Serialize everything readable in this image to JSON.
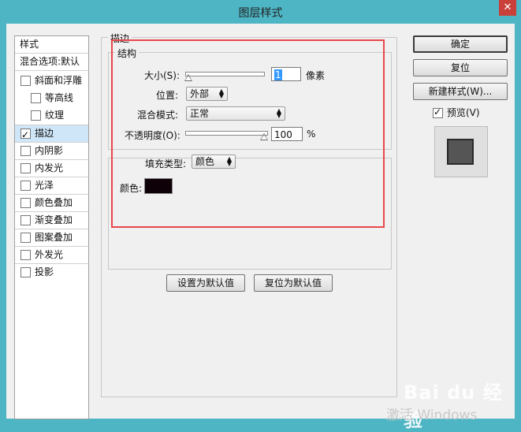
{
  "window": {
    "title": "图层样式",
    "close_glyph": "✕"
  },
  "style_list": {
    "header": "样式",
    "blend_options": "混合选项:默认",
    "items": [
      {
        "label": "斜面和浮雕",
        "checked": false
      },
      {
        "label": "等高线",
        "checked": false
      },
      {
        "label": "纹理",
        "checked": false
      },
      {
        "label": "描边",
        "checked": true,
        "selected": true
      },
      {
        "label": "内阴影",
        "checked": false
      },
      {
        "label": "内发光",
        "checked": false
      },
      {
        "label": "光泽",
        "checked": false
      },
      {
        "label": "颜色叠加",
        "checked": false
      },
      {
        "label": "渐变叠加",
        "checked": false
      },
      {
        "label": "图案叠加",
        "checked": false
      },
      {
        "label": "外发光",
        "checked": false
      },
      {
        "label": "投影",
        "checked": false
      }
    ]
  },
  "stroke_panel": {
    "title": "描边",
    "structure": {
      "title": "结构",
      "size_label": "大小(S):",
      "size_value": "1",
      "size_unit": "像素",
      "position_label": "位置:",
      "position_value": "外部",
      "blend_mode_label": "混合模式:",
      "blend_mode_value": "正常",
      "opacity_label": "不透明度(O):",
      "opacity_value": "100",
      "opacity_unit": "%"
    },
    "fill": {
      "fill_type_label": "填充类型:",
      "fill_type_value": "颜色",
      "color_label": "颜色:",
      "color_value": "#0e0208"
    },
    "set_default_button": "设置为默认值",
    "reset_default_button": "复位为默认值"
  },
  "right_panel": {
    "ok_button": "确定",
    "reset_button": "复位",
    "new_style_button": "新建样式(W)...",
    "preview_label": "预览(V)",
    "preview_checked": true
  },
  "watermark": {
    "brand": "Bai du 经验",
    "activate": "激活 Windows"
  },
  "colors": {
    "title_bar": "#4db5c4",
    "highlight_border": "#e8474b",
    "selection": "#cfe6f8"
  }
}
